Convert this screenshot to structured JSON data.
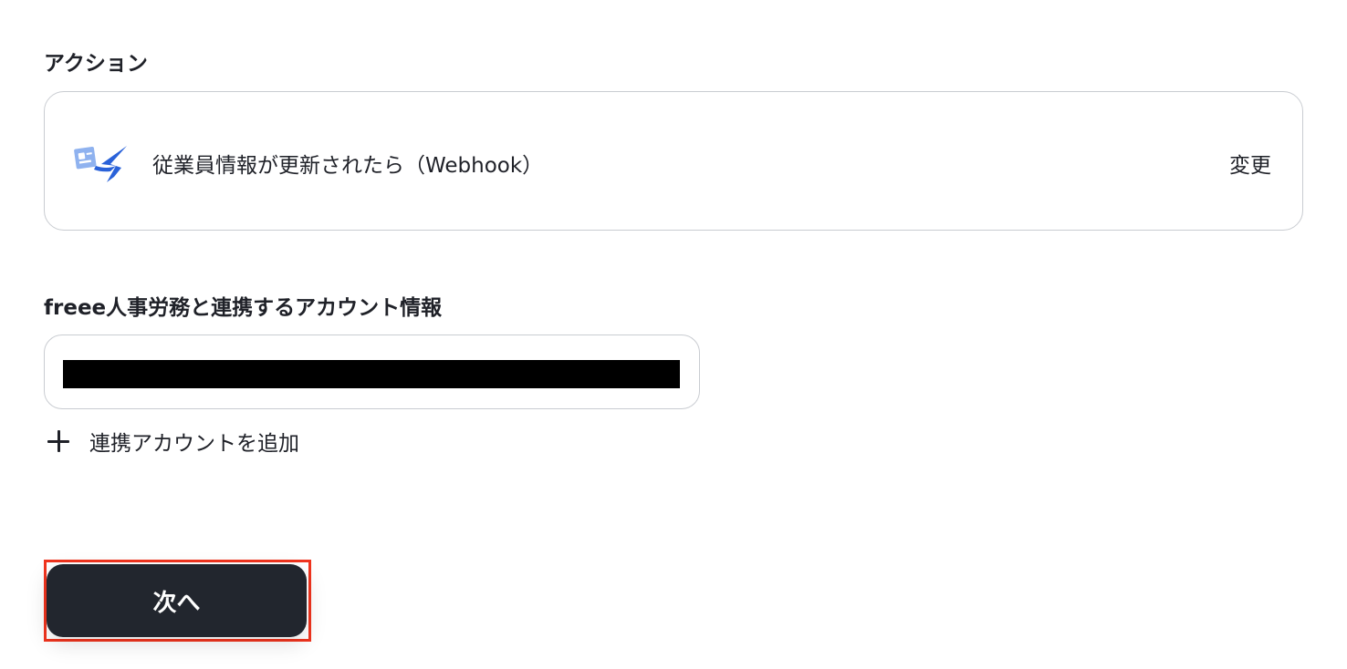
{
  "action_section": {
    "label": "アクション",
    "card": {
      "icon": "freee-hr-swallow-icon",
      "title": "従業員情報が更新されたら（Webhook）",
      "change_label": "変更"
    }
  },
  "account_section": {
    "label": "freee人事労務と連携するアカウント情報",
    "selected_value_redacted": true,
    "add_account_label": "連携アカウントを追加"
  },
  "footer": {
    "next_label": "次へ",
    "highlight_color": "#f0341e",
    "button_color": "#22262e"
  }
}
